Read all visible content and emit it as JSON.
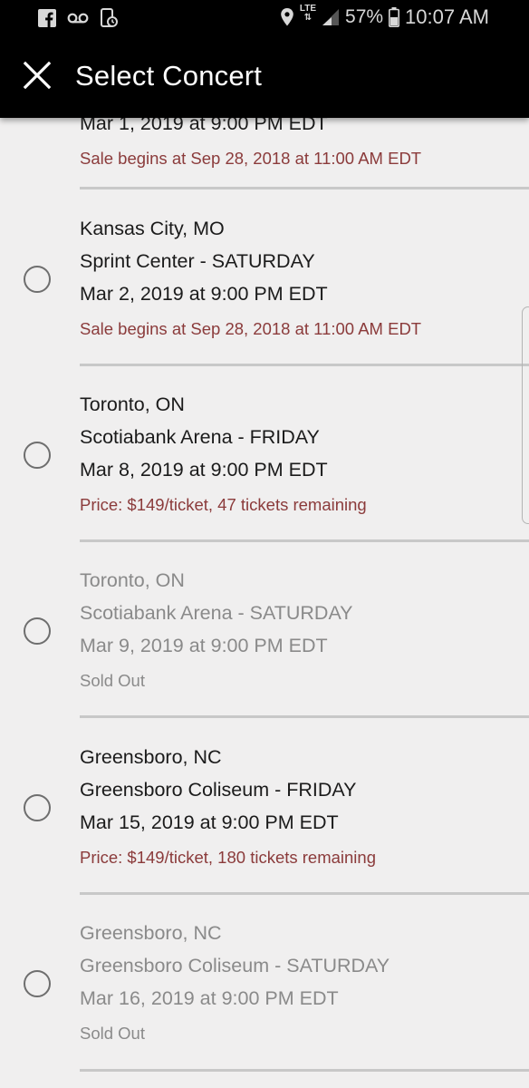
{
  "status_bar": {
    "battery": "57%",
    "time": "10:07 AM",
    "network": "LTE",
    "icons": [
      "facebook-icon",
      "voicemail-icon",
      "screen-record-icon",
      "location-icon",
      "lte-icon",
      "signal-icon",
      "battery-icon"
    ]
  },
  "app_bar": {
    "title": "Select Concert",
    "close_icon": "close-icon"
  },
  "colors": {
    "note_price": "#8b3b3b",
    "text": "#1b1b1b",
    "disabled": "#8a8a8a",
    "background": "#f0efef",
    "header": "#000000"
  },
  "concerts": [
    {
      "date": "Mar 1, 2019 at 9:00 PM EDT",
      "note": "Sale begins at Sep 28, 2018 at 11:00 AM EDT"
    },
    {
      "city": "Kansas City, MO",
      "venue": "Sprint Center - SATURDAY",
      "date": "Mar 2, 2019 at 9:00 PM EDT",
      "note": "Sale begins at Sep 28, 2018 at 11:00 AM EDT"
    },
    {
      "city": "Toronto, ON",
      "venue": "Scotiabank Arena - FRIDAY",
      "date": "Mar 8, 2019 at 9:00 PM EDT",
      "note": "Price: $149/ticket, 47 tickets remaining"
    },
    {
      "city": "Toronto, ON",
      "venue": "Scotiabank Arena - SATURDAY",
      "date": "Mar 9, 2019 at 9:00 PM EDT",
      "note": "Sold Out"
    },
    {
      "city": "Greensboro, NC",
      "venue": "Greensboro Coliseum - FRIDAY",
      "date": "Mar 15, 2019 at 9:00 PM EDT",
      "note": "Price: $149/ticket, 180 tickets remaining"
    },
    {
      "city": "Greensboro, NC",
      "venue": "Greensboro Coliseum - SATURDAY",
      "date": "Mar 16, 2019 at 9:00 PM EDT",
      "note": "Sold Out"
    }
  ]
}
